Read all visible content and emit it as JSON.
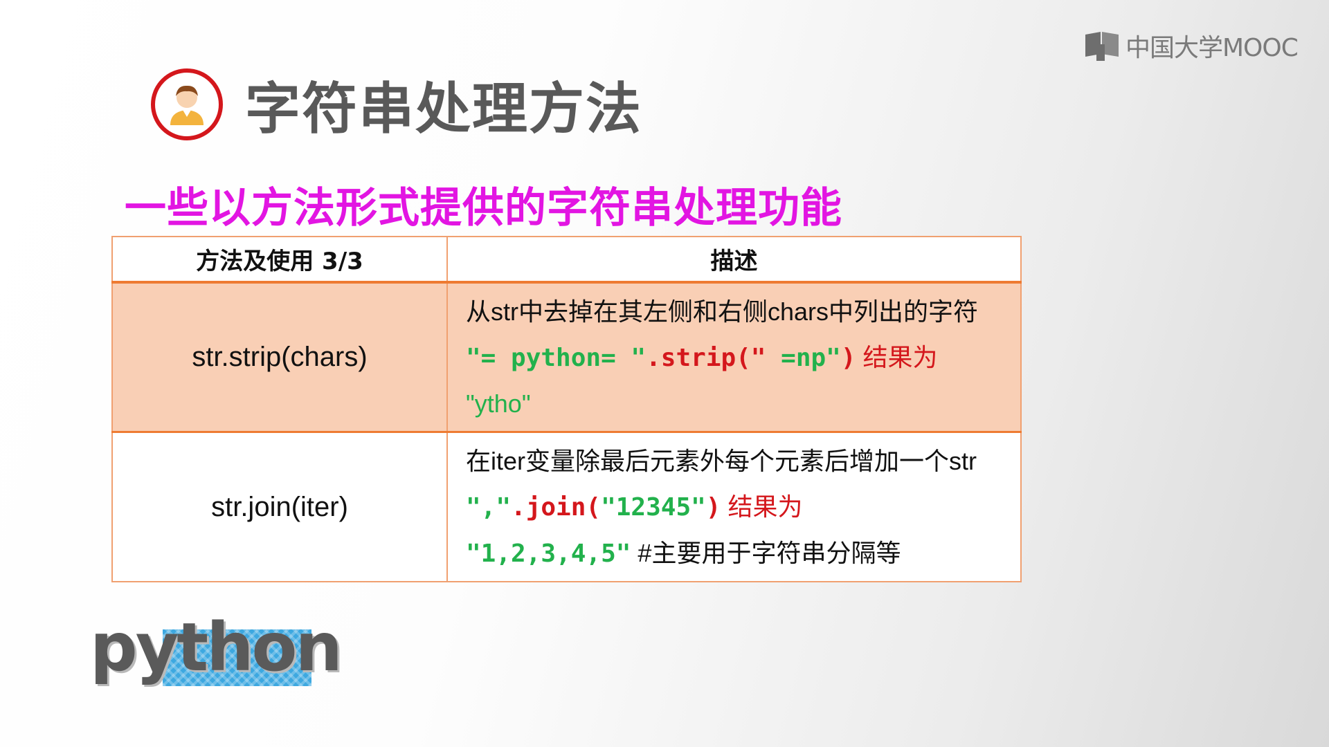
{
  "brand": {
    "logo_text": "中国大学MOOC"
  },
  "header": {
    "title": "字符串处理方法",
    "subtitle": "一些以方法形式提供的字符串处理功能"
  },
  "table": {
    "headers": [
      "方法及使用 3/3",
      "描述"
    ],
    "rows": [
      {
        "method": "str.strip(chars)",
        "desc_line1": "从str中去掉在其左侧和右侧chars中列出的字符",
        "example_str": "\"= python= \"",
        "example_call": ".strip(\"",
        "example_arg": " =np\"",
        "example_close": ")",
        "example_result_label": " 结果为",
        "example_result": "\"ytho\""
      },
      {
        "method": "str.join(iter)",
        "desc_line1": "在iter变量除最后元素外每个元素后增加一个str",
        "example_str": "\",\"",
        "example_call": ".join(",
        "example_arg": "\"12345\"",
        "example_close": ")",
        "example_result_label": " 结果为",
        "example_result": "\"1,2,3,4,5\"",
        "example_comment": "  #主要用于字符串分隔等"
      }
    ]
  },
  "footer": {
    "python_logo_text": "python"
  },
  "colors": {
    "accent_red": "#d4171c",
    "subtitle_magenta": "#e215e2",
    "code_green": "#22b14c",
    "table_highlight": "#f9cfb5",
    "table_border": "#ee7b32"
  },
  "icons": {
    "brand": "book-icon",
    "avatar": "person-avatar-icon"
  }
}
